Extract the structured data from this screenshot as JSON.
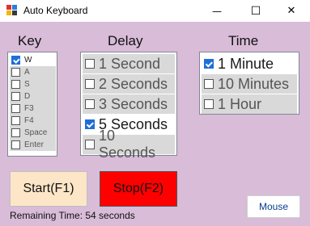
{
  "window": {
    "title": "Auto Keyboard",
    "icon": "app-icon",
    "controls": {
      "minimize": "—",
      "maximize": "☐",
      "close": "✕"
    }
  },
  "key": {
    "heading": "Key",
    "items": [
      {
        "label": "W",
        "checked": true
      },
      {
        "label": "A",
        "checked": false
      },
      {
        "label": "S",
        "checked": false
      },
      {
        "label": "D",
        "checked": false
      },
      {
        "label": "F3",
        "checked": false
      },
      {
        "label": "F4",
        "checked": false
      },
      {
        "label": "Space",
        "checked": false
      },
      {
        "label": "Enter",
        "checked": false
      }
    ]
  },
  "delay": {
    "heading": "Delay",
    "items": [
      {
        "label": "1 Second",
        "checked": false
      },
      {
        "label": "2 Seconds",
        "checked": false
      },
      {
        "label": "3 Seconds",
        "checked": false
      },
      {
        "label": "5 Seconds",
        "checked": true
      },
      {
        "label": "10 Seconds",
        "checked": false
      }
    ]
  },
  "time": {
    "heading": "Time",
    "items": [
      {
        "label": "1 Minute",
        "checked": true
      },
      {
        "label": "10 Minutes",
        "checked": false
      },
      {
        "label": "1 Hour",
        "checked": false
      }
    ]
  },
  "buttons": {
    "start": "Start(F1)",
    "stop": "Stop(F2)",
    "mouse": "Mouse"
  },
  "status": "Remaining Time: 54 seconds",
  "colors": {
    "background": "#d8bcd8",
    "start_button": "#fde6c8",
    "stop_button": "#ff0000",
    "checkbox_checked": "#1f6fd6"
  }
}
